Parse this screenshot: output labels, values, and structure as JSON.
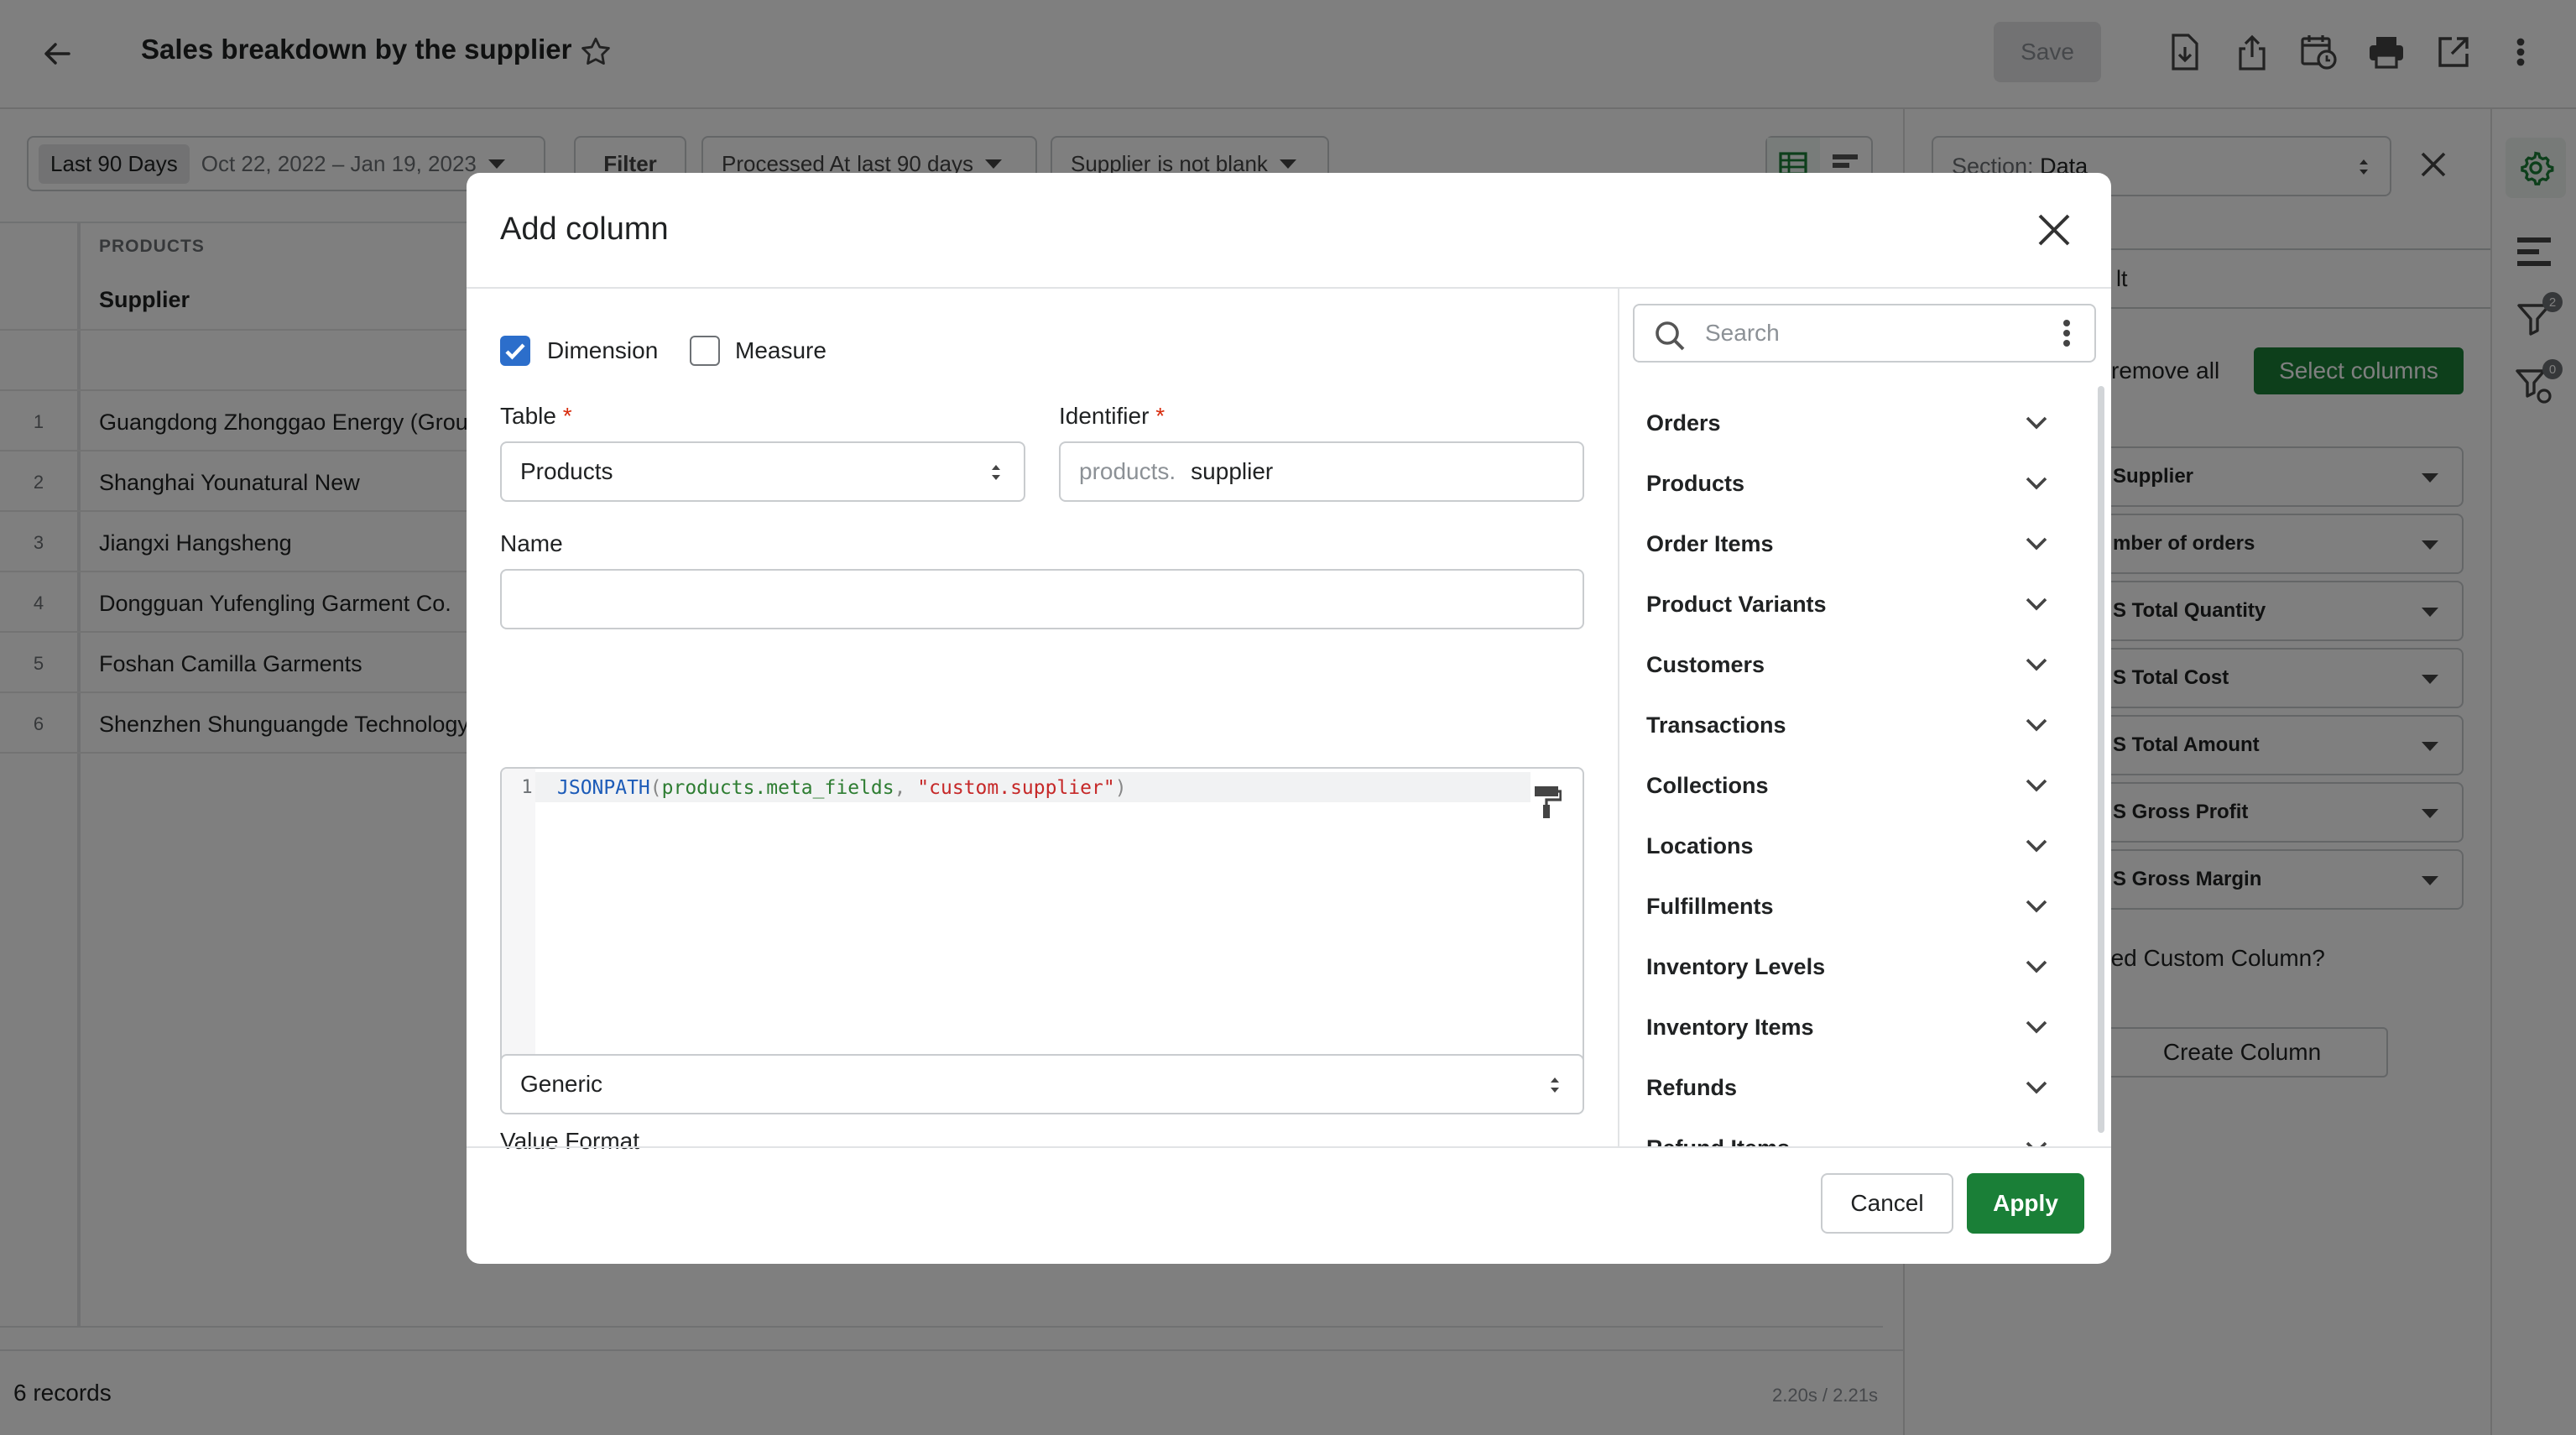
{
  "header": {
    "title": "Sales breakdown by the supplier",
    "save_label": "Save",
    "icons": [
      "back-arrow-icon",
      "star-icon",
      "download-icon",
      "share-icon",
      "schedule-icon",
      "print-icon",
      "open-external-icon",
      "more-vertical-icon"
    ]
  },
  "filters": {
    "date_tag": "Last 90 Days",
    "date_range": "Oct 22, 2022 – Jan 19, 2023",
    "filter_label": "Filter",
    "chip1_key": "Processed At",
    "chip1_val": "last 90 days",
    "chip2_key": "Supplier",
    "chip2_val": "is not blank"
  },
  "table": {
    "group_header": "PRODUCTS",
    "column_header": "Supplier",
    "rows": [
      {
        "num": "1",
        "supplier": "Guangdong Zhonggao Energy (Grou"
      },
      {
        "num": "2",
        "supplier": "Shanghai Younatural New"
      },
      {
        "num": "3",
        "supplier": "Jiangxi Hangsheng"
      },
      {
        "num": "4",
        "supplier": "Dongguan Yufengling Garment Co."
      },
      {
        "num": "5",
        "supplier": "Foshan Camilla Garments"
      },
      {
        "num": "6",
        "supplier": "Shenzhen Shunguangde Technology"
      }
    ],
    "records": "6 records",
    "timing": "2.20s / 2.21s"
  },
  "side_panel": {
    "section_key": "Section:",
    "section_val": "Data",
    "second_select": "lt",
    "remove_all": "remove all",
    "select_columns": "Select columns",
    "columns": [
      "Supplier",
      "mber of orders",
      "S Total Quantity",
      "S Total Cost",
      "S Total Amount",
      "S Gross Profit",
      "S Gross Margin"
    ],
    "custom_q": "eed Custom Column?",
    "create_column": "Create Column",
    "rail_badges": {
      "filter": "2",
      "filter_settings": "0"
    }
  },
  "modal": {
    "title": "Add column",
    "dimension_label": "Dimension",
    "dimension_checked": true,
    "measure_label": "Measure",
    "measure_checked": false,
    "table_label": "Table",
    "table_value": "Products",
    "identifier_label": "Identifier",
    "identifier_prefix": "products.",
    "identifier_value": "supplier",
    "required_mark": "*",
    "name_label": "Name",
    "name_value": "",
    "code_line_number": "1",
    "code_fn": "JSONPATH",
    "code_paren_open": "(",
    "code_arg": "products.meta_fields",
    "code_comma": ", ",
    "code_str": "\"custom.supplier\"",
    "code_paren_close": ")",
    "value_format_label": "Value Format",
    "value_format_value": "Generic",
    "search_placeholder": "Search",
    "tables": [
      "Orders",
      "Products",
      "Order Items",
      "Product Variants",
      "Customers",
      "Transactions",
      "Collections",
      "Locations",
      "Fulfillments",
      "Inventory Levels",
      "Inventory Items",
      "Refunds",
      "Refund Items"
    ],
    "cancel_label": "Cancel",
    "apply_label": "Apply"
  },
  "colors": {
    "accent_green": "#1a7f37",
    "checkbox_blue": "#2c6ecb",
    "code_fn_blue": "#1c5bb8",
    "code_arg_green": "#2e7d32",
    "code_str_red": "#c62828"
  }
}
